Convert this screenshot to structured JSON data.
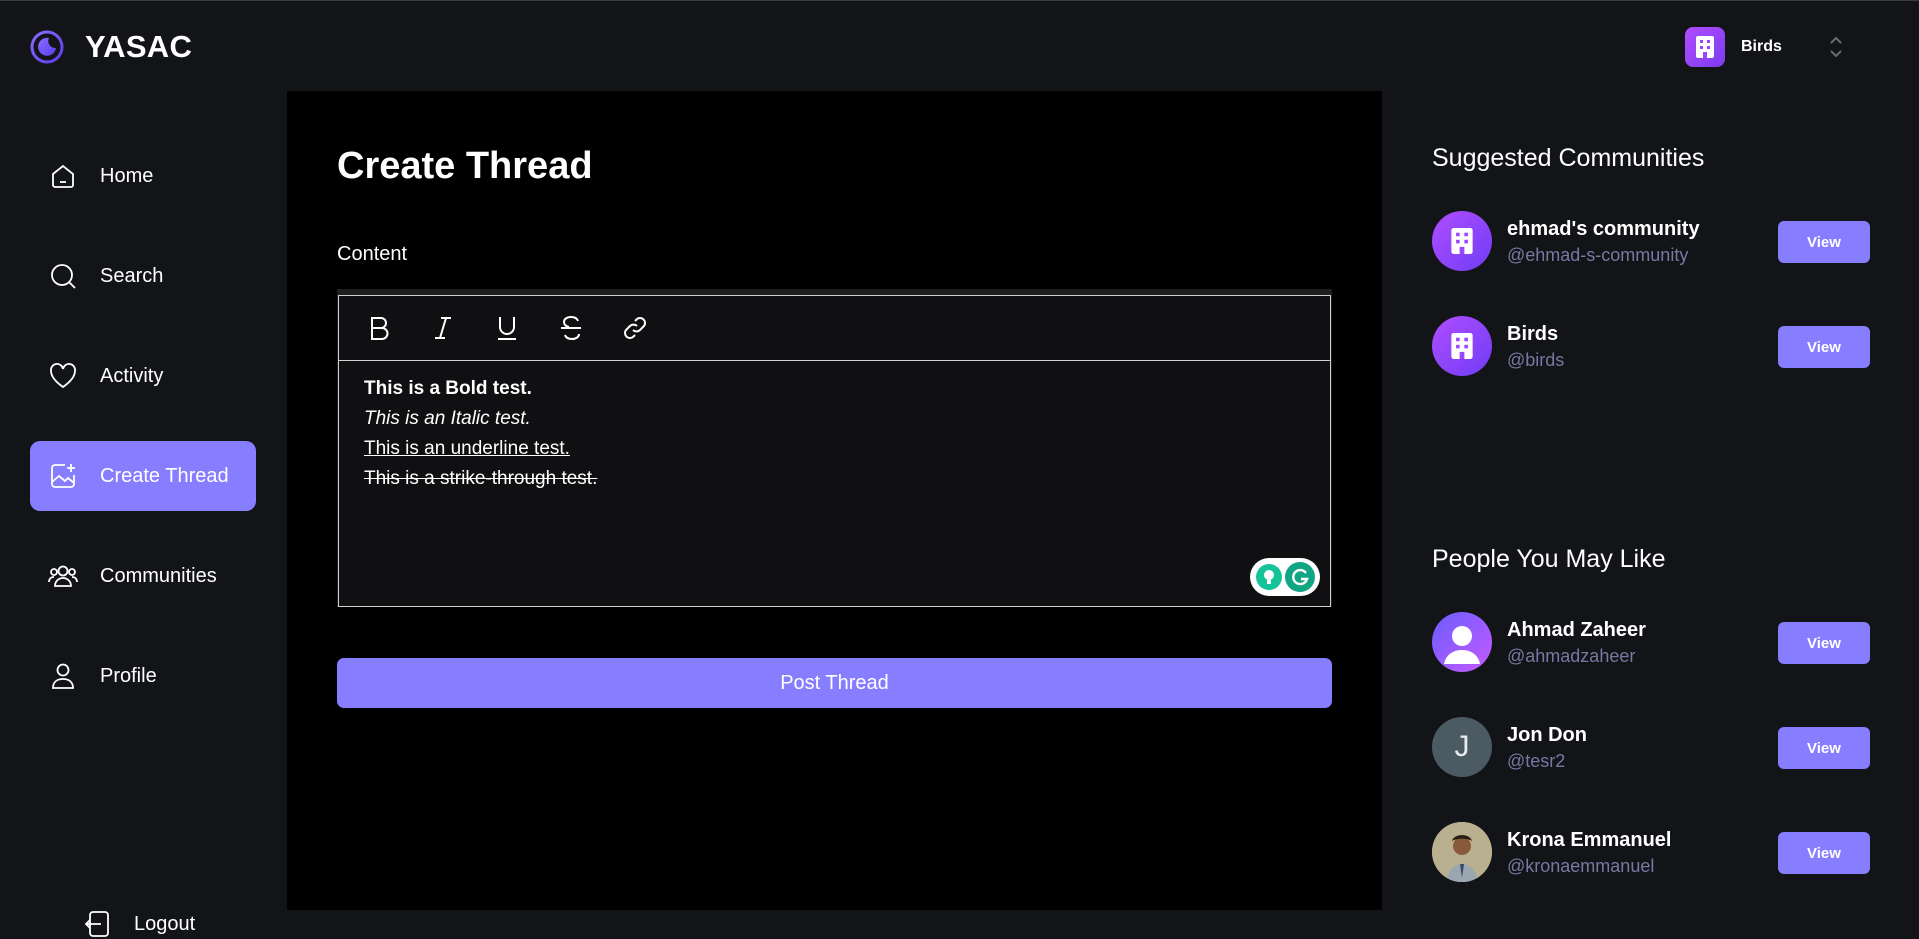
{
  "app": {
    "title": "YASAC",
    "accent": "#877eff"
  },
  "org_switcher": {
    "name": "Birds"
  },
  "sidebar": {
    "items": [
      {
        "label": "Home",
        "icon": "home-icon",
        "active": false
      },
      {
        "label": "Search",
        "icon": "search-icon",
        "active": false
      },
      {
        "label": "Activity",
        "icon": "heart-icon",
        "active": false
      },
      {
        "label": "Create Thread",
        "icon": "image-plus-icon",
        "active": true
      },
      {
        "label": "Communities",
        "icon": "users-icon",
        "active": false
      },
      {
        "label": "Profile",
        "icon": "user-icon",
        "active": false
      }
    ],
    "logout_label": "Logout"
  },
  "main": {
    "title": "Create Thread",
    "content_label": "Content",
    "toolbar": [
      "bold-icon",
      "italic-icon",
      "underline-icon",
      "strikethrough-icon",
      "link-icon"
    ],
    "editor_lines": {
      "bold": "This is a Bold test.",
      "italic": "This is an Italic test.",
      "underline": "This is an underline test.",
      "strike": "This is a strike-through test."
    },
    "post_button": "Post Thread"
  },
  "right": {
    "suggested_title": "Suggested Communities",
    "communities": [
      {
        "name": "ehmad's community",
        "handle": "@ehmad-s-community",
        "button": "View"
      },
      {
        "name": "Birds",
        "handle": "@birds",
        "button": "View"
      }
    ],
    "people_title": "People You May Like",
    "people": [
      {
        "name": "Ahmad Zaheer",
        "handle": "@ahmadzaheer",
        "button": "View"
      },
      {
        "name": "Jon Don",
        "handle": "@tesr2",
        "initial": "J",
        "button": "View"
      },
      {
        "name": "Krona Emmanuel",
        "handle": "@kronaemmanuel",
        "button": "View"
      }
    ]
  }
}
